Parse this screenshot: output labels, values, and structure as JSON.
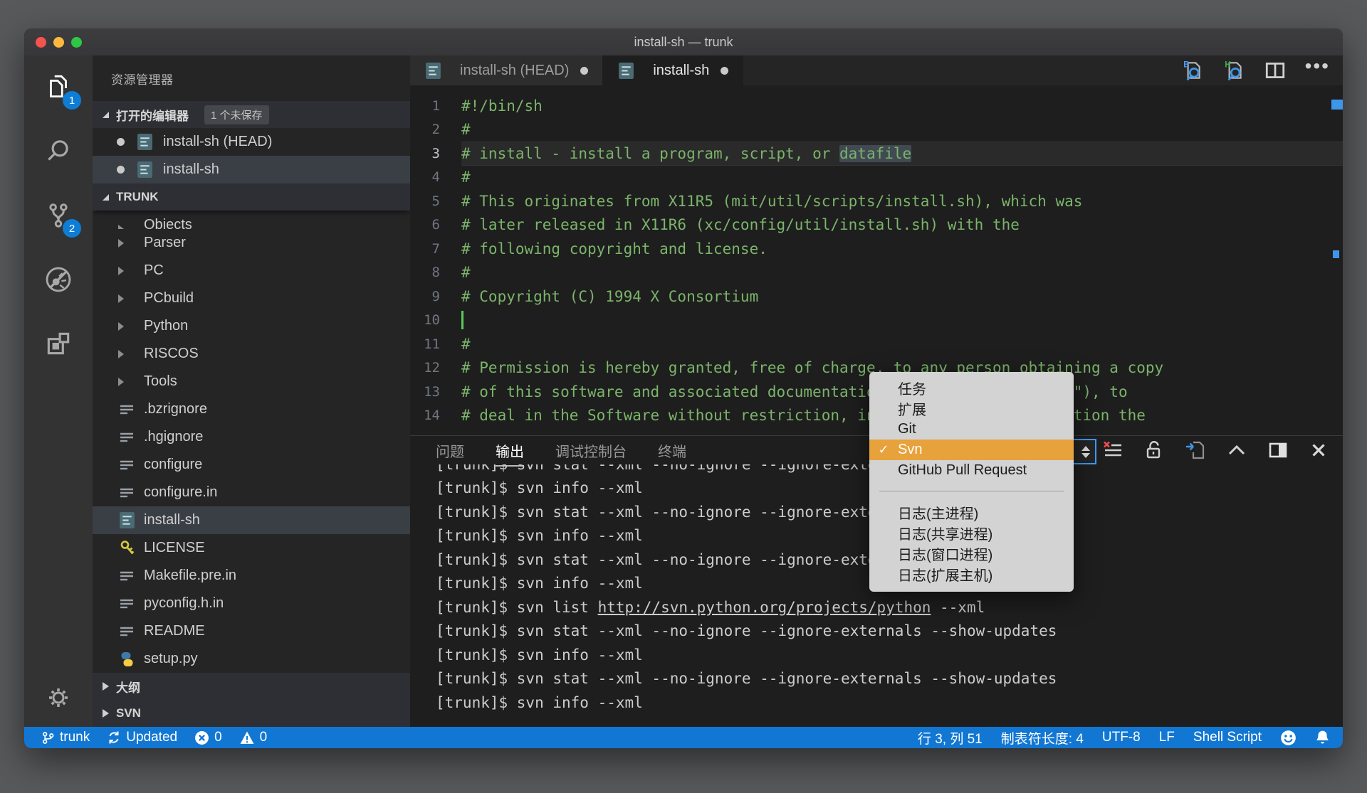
{
  "window": {
    "title": "install-sh — trunk"
  },
  "colors": {
    "status": "#1277d3",
    "badge": "#0d7dd6",
    "menu-hl": "#e8a23c",
    "green": "#7bb46a",
    "blue": "#3e96e8"
  },
  "activity_bar": {
    "explorer_badge": "1",
    "scm_badge": "2"
  },
  "sidebar": {
    "title": "资源管理器",
    "open_editors": {
      "label": "打开的编辑器",
      "badge": "1 个未保存",
      "items": [
        {
          "label": "install-sh (HEAD)"
        },
        {
          "label": "install-sh",
          "cls": "selected"
        }
      ]
    },
    "tree_label": "TRUNK",
    "rows": [
      {
        "label": "Objects",
        "cls": "folder clipped"
      },
      {
        "label": "Parser",
        "cls": "folder"
      },
      {
        "label": "PC",
        "cls": "folder"
      },
      {
        "label": "PCbuild",
        "cls": "folder"
      },
      {
        "label": "Python",
        "cls": "folder"
      },
      {
        "label": "RISCOS",
        "cls": "folder"
      },
      {
        "label": "Tools",
        "cls": "folder"
      },
      {
        "label": ".bzrignore",
        "cls": "file list"
      },
      {
        "label": ".hgignore",
        "cls": "file list"
      },
      {
        "label": "configure",
        "cls": "file list"
      },
      {
        "label": "configure.in",
        "cls": "file list"
      },
      {
        "label": "install-sh",
        "cls": "file doc selected"
      },
      {
        "label": "LICENSE",
        "cls": "file key"
      },
      {
        "label": "Makefile.pre.in",
        "cls": "file list"
      },
      {
        "label": "pyconfig.h.in",
        "cls": "file list"
      },
      {
        "label": "README",
        "cls": "file list"
      },
      {
        "label": "setup.py",
        "cls": "file py"
      }
    ],
    "sections": [
      {
        "label": "大纲"
      },
      {
        "label": "SVN"
      }
    ]
  },
  "tabs": [
    {
      "label": "install-sh (HEAD)"
    },
    {
      "label": "install-sh",
      "cls": "active"
    }
  ],
  "editor": {
    "lines": [
      {
        "num": "1",
        "text": "#!/bin/sh"
      },
      {
        "num": "2",
        "text": "#"
      },
      {
        "num": "3",
        "text": "# install - install a program, script, or ",
        "highlight": "datafile",
        "cls": "current"
      },
      {
        "num": "4",
        "text": "#"
      },
      {
        "num": "5",
        "text": "# This originates from X11R5 (mit/util/scripts/install.sh), which was"
      },
      {
        "num": "6",
        "text": "# later released in X11R6 (xc/config/util/install.sh) with the"
      },
      {
        "num": "7",
        "text": "# following copyright and license."
      },
      {
        "num": "8",
        "text": "#"
      },
      {
        "num": "9",
        "text": "# Copyright (C) 1994 X Consortium"
      },
      {
        "num": "10",
        "text": "",
        "cls": "cursor-line"
      },
      {
        "num": "11",
        "text": "#"
      },
      {
        "num": "12",
        "text": "# Permission is hereby granted, free of charge, to any person obtaining a copy"
      },
      {
        "num": "13",
        "text": "# of this software and associated documentation files (the \"Software\"), to"
      },
      {
        "num": "14",
        "text": "# deal in the Software without restriction, including without limitation the"
      }
    ]
  },
  "panel": {
    "tabs": [
      {
        "label": "问题"
      },
      {
        "label": "输出",
        "cls": "active"
      },
      {
        "label": "调试控制台"
      },
      {
        "label": "终端"
      }
    ],
    "output": [
      {
        "pre": "[trunk]$ svn stat --xml --no-ignore --ignore-externals --show-updates",
        "cls": "clip"
      },
      {
        "pre": "[trunk]$ svn info --xml"
      },
      {
        "pre": "[trunk]$ svn stat --xml --no-ignore --ignore-externals --show-updates"
      },
      {
        "pre": "[trunk]$ svn info --xml"
      },
      {
        "pre": "[trunk]$ svn stat --xml --no-ignore --ignore-externals --show-updates"
      },
      {
        "pre": "[trunk]$ svn info --xml"
      },
      {
        "pre": "[trunk]$ svn list ",
        "link": "http://svn.python.org/projects/python",
        "post": " --xml"
      },
      {
        "pre": "[trunk]$ svn stat --xml --no-ignore --ignore-externals --show-updates"
      },
      {
        "pre": "[trunk]$ svn info --xml"
      },
      {
        "pre": "[trunk]$ svn stat --xml --no-ignore --ignore-externals --show-updates"
      },
      {
        "pre": "[trunk]$ svn info --xml"
      }
    ]
  },
  "dropdown": {
    "items": [
      {
        "label": "任务"
      },
      {
        "label": "扩展"
      },
      {
        "label": "Git"
      },
      {
        "label": "Svn",
        "cls": "checked",
        "check": "✓"
      },
      {
        "label": "GitHub Pull Request"
      }
    ],
    "log_items": [
      {
        "label": "日志(主进程)"
      },
      {
        "label": "日志(共享进程)"
      },
      {
        "label": "日志(窗口进程)"
      },
      {
        "label": "日志(扩展主机)"
      }
    ]
  },
  "status_bar": {
    "branch": "trunk",
    "sync": "Updated",
    "errors": "0",
    "warnings": "0",
    "right": [
      {
        "label": "行 3, 列 51"
      },
      {
        "label": "制表符长度: 4"
      },
      {
        "label": "UTF-8"
      },
      {
        "label": "LF"
      },
      {
        "label": "Shell Script"
      }
    ]
  }
}
